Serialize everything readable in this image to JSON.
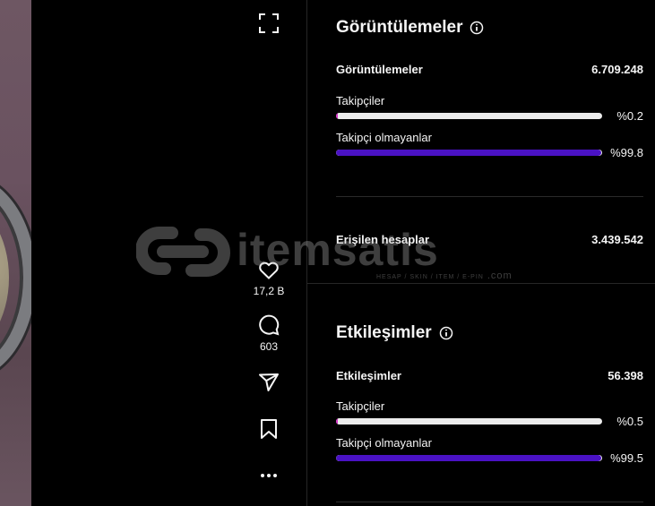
{
  "watermark": {
    "brand": "itemsatis",
    "tagline": "HESAP / SKIN / ITEM / E-PIN",
    "domain": ".com"
  },
  "post_actions": {
    "like_count": "17,2 B",
    "comment_count": "603"
  },
  "views_section": {
    "title": "Görüntülemeler",
    "total_label": "Görüntülemeler",
    "total_value": "6.709.248",
    "followers_label": "Takipçiler",
    "followers_pct": "%0.2",
    "followers_fraction": 0.002,
    "nonfollowers_label": "Takipçi olmayanlar",
    "nonfollowers_pct": "%99.8",
    "nonfollowers_fraction": 0.998,
    "reach_label": "Erişilen hesaplar",
    "reach_value": "3.439.542"
  },
  "interactions_section": {
    "title": "Etkileşimler",
    "total_label": "Etkileşimler",
    "total_value": "56.398",
    "followers_label": "Takipçiler",
    "followers_pct": "%0.5",
    "followers_fraction": 0.005,
    "nonfollowers_label": "Takipçi olmayanlar",
    "nonfollowers_pct": "%99.5",
    "nonfollowers_fraction": 0.995
  },
  "colors": {
    "followers_bar": "#d632c8",
    "nonfollowers_bar": "#4a12c4",
    "track": "#ececec"
  },
  "icons": [
    "fullscreen-icon",
    "heart-icon",
    "comment-icon",
    "share-icon",
    "bookmark-icon",
    "more-icon",
    "info-icon"
  ]
}
